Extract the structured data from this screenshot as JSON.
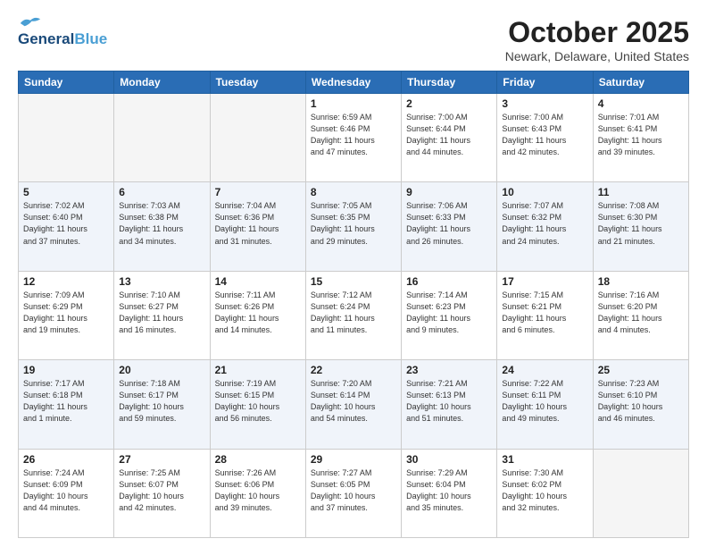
{
  "header": {
    "logo_line1": "General",
    "logo_line2": "Blue",
    "month": "October 2025",
    "location": "Newark, Delaware, United States"
  },
  "weekdays": [
    "Sunday",
    "Monday",
    "Tuesday",
    "Wednesday",
    "Thursday",
    "Friday",
    "Saturday"
  ],
  "weeks": [
    [
      {
        "day": "",
        "empty": true
      },
      {
        "day": "",
        "empty": true
      },
      {
        "day": "",
        "empty": true
      },
      {
        "day": "1",
        "info": "Sunrise: 6:59 AM\nSunset: 6:46 PM\nDaylight: 11 hours\nand 47 minutes."
      },
      {
        "day": "2",
        "info": "Sunrise: 7:00 AM\nSunset: 6:44 PM\nDaylight: 11 hours\nand 44 minutes."
      },
      {
        "day": "3",
        "info": "Sunrise: 7:00 AM\nSunset: 6:43 PM\nDaylight: 11 hours\nand 42 minutes."
      },
      {
        "day": "4",
        "info": "Sunrise: 7:01 AM\nSunset: 6:41 PM\nDaylight: 11 hours\nand 39 minutes."
      }
    ],
    [
      {
        "day": "5",
        "info": "Sunrise: 7:02 AM\nSunset: 6:40 PM\nDaylight: 11 hours\nand 37 minutes."
      },
      {
        "day": "6",
        "info": "Sunrise: 7:03 AM\nSunset: 6:38 PM\nDaylight: 11 hours\nand 34 minutes."
      },
      {
        "day": "7",
        "info": "Sunrise: 7:04 AM\nSunset: 6:36 PM\nDaylight: 11 hours\nand 31 minutes."
      },
      {
        "day": "8",
        "info": "Sunrise: 7:05 AM\nSunset: 6:35 PM\nDaylight: 11 hours\nand 29 minutes."
      },
      {
        "day": "9",
        "info": "Sunrise: 7:06 AM\nSunset: 6:33 PM\nDaylight: 11 hours\nand 26 minutes."
      },
      {
        "day": "10",
        "info": "Sunrise: 7:07 AM\nSunset: 6:32 PM\nDaylight: 11 hours\nand 24 minutes."
      },
      {
        "day": "11",
        "info": "Sunrise: 7:08 AM\nSunset: 6:30 PM\nDaylight: 11 hours\nand 21 minutes."
      }
    ],
    [
      {
        "day": "12",
        "info": "Sunrise: 7:09 AM\nSunset: 6:29 PM\nDaylight: 11 hours\nand 19 minutes."
      },
      {
        "day": "13",
        "info": "Sunrise: 7:10 AM\nSunset: 6:27 PM\nDaylight: 11 hours\nand 16 minutes."
      },
      {
        "day": "14",
        "info": "Sunrise: 7:11 AM\nSunset: 6:26 PM\nDaylight: 11 hours\nand 14 minutes."
      },
      {
        "day": "15",
        "info": "Sunrise: 7:12 AM\nSunset: 6:24 PM\nDaylight: 11 hours\nand 11 minutes."
      },
      {
        "day": "16",
        "info": "Sunrise: 7:14 AM\nSunset: 6:23 PM\nDaylight: 11 hours\nand 9 minutes."
      },
      {
        "day": "17",
        "info": "Sunrise: 7:15 AM\nSunset: 6:21 PM\nDaylight: 11 hours\nand 6 minutes."
      },
      {
        "day": "18",
        "info": "Sunrise: 7:16 AM\nSunset: 6:20 PM\nDaylight: 11 hours\nand 4 minutes."
      }
    ],
    [
      {
        "day": "19",
        "info": "Sunrise: 7:17 AM\nSunset: 6:18 PM\nDaylight: 11 hours\nand 1 minute."
      },
      {
        "day": "20",
        "info": "Sunrise: 7:18 AM\nSunset: 6:17 PM\nDaylight: 10 hours\nand 59 minutes."
      },
      {
        "day": "21",
        "info": "Sunrise: 7:19 AM\nSunset: 6:15 PM\nDaylight: 10 hours\nand 56 minutes."
      },
      {
        "day": "22",
        "info": "Sunrise: 7:20 AM\nSunset: 6:14 PM\nDaylight: 10 hours\nand 54 minutes."
      },
      {
        "day": "23",
        "info": "Sunrise: 7:21 AM\nSunset: 6:13 PM\nDaylight: 10 hours\nand 51 minutes."
      },
      {
        "day": "24",
        "info": "Sunrise: 7:22 AM\nSunset: 6:11 PM\nDaylight: 10 hours\nand 49 minutes."
      },
      {
        "day": "25",
        "info": "Sunrise: 7:23 AM\nSunset: 6:10 PM\nDaylight: 10 hours\nand 46 minutes."
      }
    ],
    [
      {
        "day": "26",
        "info": "Sunrise: 7:24 AM\nSunset: 6:09 PM\nDaylight: 10 hours\nand 44 minutes."
      },
      {
        "day": "27",
        "info": "Sunrise: 7:25 AM\nSunset: 6:07 PM\nDaylight: 10 hours\nand 42 minutes."
      },
      {
        "day": "28",
        "info": "Sunrise: 7:26 AM\nSunset: 6:06 PM\nDaylight: 10 hours\nand 39 minutes."
      },
      {
        "day": "29",
        "info": "Sunrise: 7:27 AM\nSunset: 6:05 PM\nDaylight: 10 hours\nand 37 minutes."
      },
      {
        "day": "30",
        "info": "Sunrise: 7:29 AM\nSunset: 6:04 PM\nDaylight: 10 hours\nand 35 minutes."
      },
      {
        "day": "31",
        "info": "Sunrise: 7:30 AM\nSunset: 6:02 PM\nDaylight: 10 hours\nand 32 minutes."
      },
      {
        "day": "",
        "empty": true
      }
    ]
  ]
}
